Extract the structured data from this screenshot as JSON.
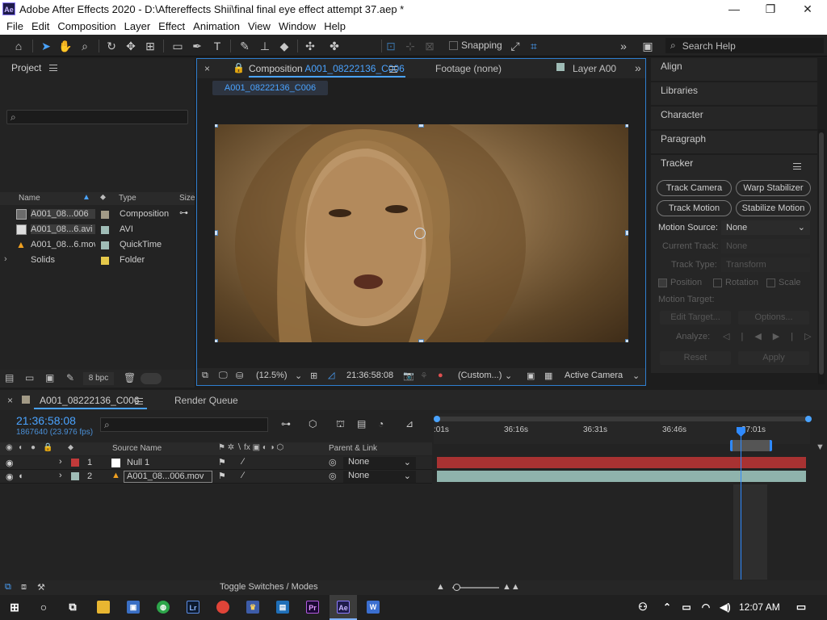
{
  "window": {
    "title": "Adobe After Effects 2020 - D:\\Aftereffects Shii\\final final eye effect attempt 37.aep *",
    "app_icon": "Ae",
    "minimize": "—",
    "maximize": "❐",
    "close": "✕"
  },
  "menu": [
    "File",
    "Edit",
    "Composition",
    "Layer",
    "Effect",
    "Animation",
    "View",
    "Window",
    "Help"
  ],
  "toolbar": {
    "snapping_label": "Snapping",
    "search_placeholder": "Search Help",
    "overflow": "»"
  },
  "project": {
    "title": "Project",
    "columns": {
      "name": "Name",
      "type": "Type",
      "size": "Size"
    },
    "items": [
      {
        "name": "A001_08...006",
        "type": "Composition",
        "color": "#a29a86",
        "icon": "composition-icon"
      },
      {
        "name": "A001_08...6.avi",
        "type": "AVI",
        "color": "#9fbcb6",
        "icon": "avi-file-icon"
      },
      {
        "name": "A001_08...6.mov",
        "type": "QuickTime",
        "color": "#9fbcb6",
        "icon": "quicktime-file-icon"
      },
      {
        "name": "Solids",
        "type": "Folder",
        "color": "#e5c84a",
        "icon": "folder-icon"
      }
    ],
    "bpc": "8 bpc"
  },
  "composition": {
    "tab_prefix": "Composition",
    "tab_name": "A001_08222136_C006",
    "footage_tab": "Footage (none)",
    "layer_tab": "Layer A00",
    "breadcrumb": "A001_08222136_C006",
    "zoom": "(12.5%)",
    "timecode": "21:36:58:08",
    "resolution": "(Custom...)",
    "camera": "Active Camera"
  },
  "right_panels": {
    "sections": [
      "Align",
      "Libraries",
      "Character",
      "Paragraph"
    ],
    "tracker": {
      "title": "Tracker",
      "buttons": [
        "Track Camera",
        "Warp Stabilizer",
        "Track Motion",
        "Stabilize Motion"
      ],
      "motion_source_label": "Motion Source:",
      "motion_source_value": "None",
      "current_track_label": "Current Track:",
      "current_track_value": "None",
      "track_type_label": "Track Type:",
      "track_type_value": "Transform",
      "position": "Position",
      "rotation": "Rotation",
      "scale": "Scale",
      "motion_target_label": "Motion Target:",
      "edit_target": "Edit Target...",
      "options": "Options...",
      "analyze_label": "Analyze:",
      "reset": "Reset",
      "apply": "Apply"
    }
  },
  "timeline": {
    "comp_tab": "A001_08222136_C006",
    "render_queue_tab": "Render Queue",
    "timecode": "21:36:58:08",
    "frames": "1867640 (23.976 fps)",
    "columns": {
      "source_name": "Source Name",
      "parent_link": "Parent & Link"
    },
    "ruler_labels": [
      ":01s",
      "36:16s",
      "36:31s",
      "36:46s",
      "37:01s"
    ],
    "layers": [
      {
        "num": "1",
        "name": "Null 1",
        "parent": "None",
        "color": "#c23a3a"
      },
      {
        "num": "2",
        "name": "A001_08...006.mov",
        "parent": "None",
        "color": "#9fbcb6"
      }
    ],
    "footer_label": "Toggle Switches / Modes"
  },
  "taskbar": {
    "time": "12:07 AM"
  }
}
